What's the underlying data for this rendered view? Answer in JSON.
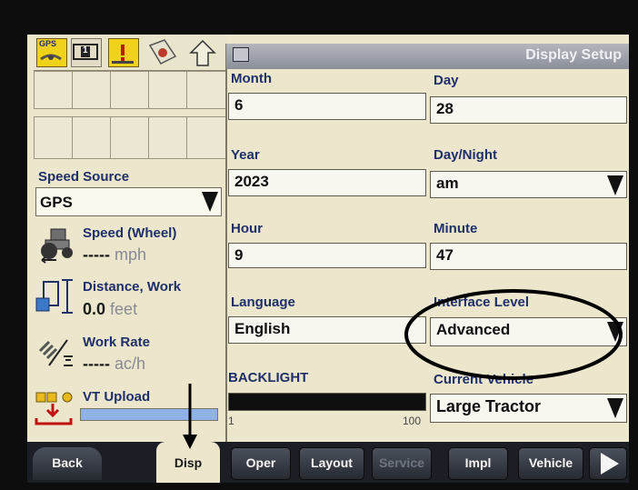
{
  "screen": {
    "title": "Display Setup"
  },
  "status_icons": [
    {
      "name": "gps-icon",
      "label": "GPS"
    },
    {
      "name": "section-one-icon",
      "label": "1"
    },
    {
      "name": "alert-icon",
      "label": ""
    },
    {
      "name": "rate-icon",
      "label": ""
    },
    {
      "name": "up-arrow-icon",
      "label": ""
    }
  ],
  "left_panel": {
    "speed_source": {
      "label": "Speed Source",
      "value": "GPS"
    },
    "speed": {
      "label": "Speed (Wheel)",
      "value": "-----",
      "unit": "mph"
    },
    "distance": {
      "label": "Distance, Work",
      "value": "0.0",
      "unit": "feet"
    },
    "work_rate": {
      "label": "Work Rate",
      "value": "-----",
      "unit": "ac/h"
    },
    "vt_upload": {
      "label": "VT Upload",
      "progress": 1.0
    }
  },
  "fields": {
    "month": {
      "label": "Month",
      "value": "6"
    },
    "day": {
      "label": "Day",
      "value": "28"
    },
    "year": {
      "label": "Year",
      "value": "2023"
    },
    "day_night": {
      "label": "Day/Night",
      "value": "am"
    },
    "hour": {
      "label": "Hour",
      "value": "9"
    },
    "minute": {
      "label": "Minute",
      "value": "47"
    },
    "language": {
      "label": "Language",
      "value": "English"
    },
    "interface_level": {
      "label": "Interface Level",
      "value": "Advanced"
    },
    "backlight": {
      "label": "BACKLIGHT",
      "min": "1",
      "max": "100",
      "level": 1.0
    },
    "current_vehicle": {
      "label": "Current Vehicle",
      "value": "Large Tractor"
    }
  },
  "nav": {
    "back": "Back",
    "disp": "Disp",
    "oper": "Oper",
    "layout": "Layout",
    "service": "Service",
    "impl": "Impl",
    "vehicle": "Vehicle"
  },
  "colors": {
    "panel_bg": "#ece6cc",
    "label_blue": "#1e2f6a",
    "progress_blue": "#8fb3e6",
    "annotation": "#000000"
  }
}
